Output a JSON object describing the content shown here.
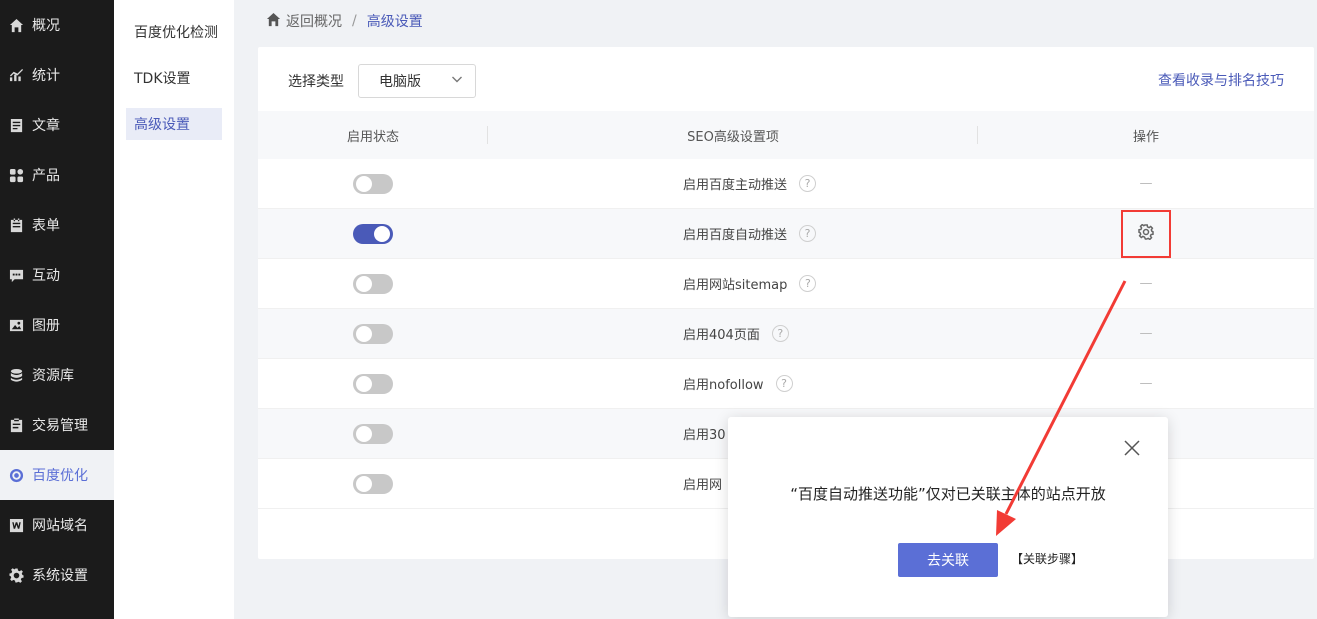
{
  "sidebar": {
    "items": [
      {
        "label": "概况",
        "icon": "home-icon"
      },
      {
        "label": "统计",
        "icon": "stats-icon"
      },
      {
        "label": "文章",
        "icon": "article-icon"
      },
      {
        "label": "产品",
        "icon": "product-icon"
      },
      {
        "label": "表单",
        "icon": "form-icon"
      },
      {
        "label": "互动",
        "icon": "chat-icon"
      },
      {
        "label": "图册",
        "icon": "gallery-icon"
      },
      {
        "label": "资源库",
        "icon": "database-icon"
      },
      {
        "label": "交易管理",
        "icon": "trade-icon"
      },
      {
        "label": "百度优化",
        "icon": "seo-icon",
        "active": true
      },
      {
        "label": "网站域名",
        "icon": "domain-icon"
      },
      {
        "label": "系统设置",
        "icon": "settings-icon"
      }
    ]
  },
  "submenu": {
    "items": [
      {
        "label": "百度优化检测"
      },
      {
        "label": "TDK设置"
      },
      {
        "label": "高级设置",
        "active": true
      }
    ]
  },
  "breadcrumb": {
    "back_label": "返回概况",
    "separator": "/",
    "current": "高级设置"
  },
  "filter": {
    "label": "选择类型",
    "selected": "电脑版"
  },
  "tips_link": "查看收录与排名技巧",
  "table": {
    "columns": [
      "启用状态",
      "SEO高级设置项",
      "操作"
    ],
    "rows": [
      {
        "enabled": false,
        "label": "启用百度主动推送",
        "action": "—"
      },
      {
        "enabled": true,
        "label": "启用百度自动推送",
        "action": "gear"
      },
      {
        "enabled": false,
        "label": "启用网站sitemap",
        "action": "—"
      },
      {
        "enabled": false,
        "label": "启用404页面",
        "action": "—"
      },
      {
        "enabled": false,
        "label": "启用nofollow",
        "action": "—"
      },
      {
        "enabled": false,
        "label": "启用30",
        "action": ""
      },
      {
        "enabled": false,
        "label": "启用网",
        "action": ""
      }
    ]
  },
  "dialog": {
    "message": "“百度自动推送功能”仅对已关联主体的站点开放",
    "button": "去关联",
    "link": "【关联步骤】"
  },
  "colors": {
    "accent": "#5b6fd6",
    "sidebar_bg": "#1b1b1b",
    "highlight": "#f23b35"
  }
}
